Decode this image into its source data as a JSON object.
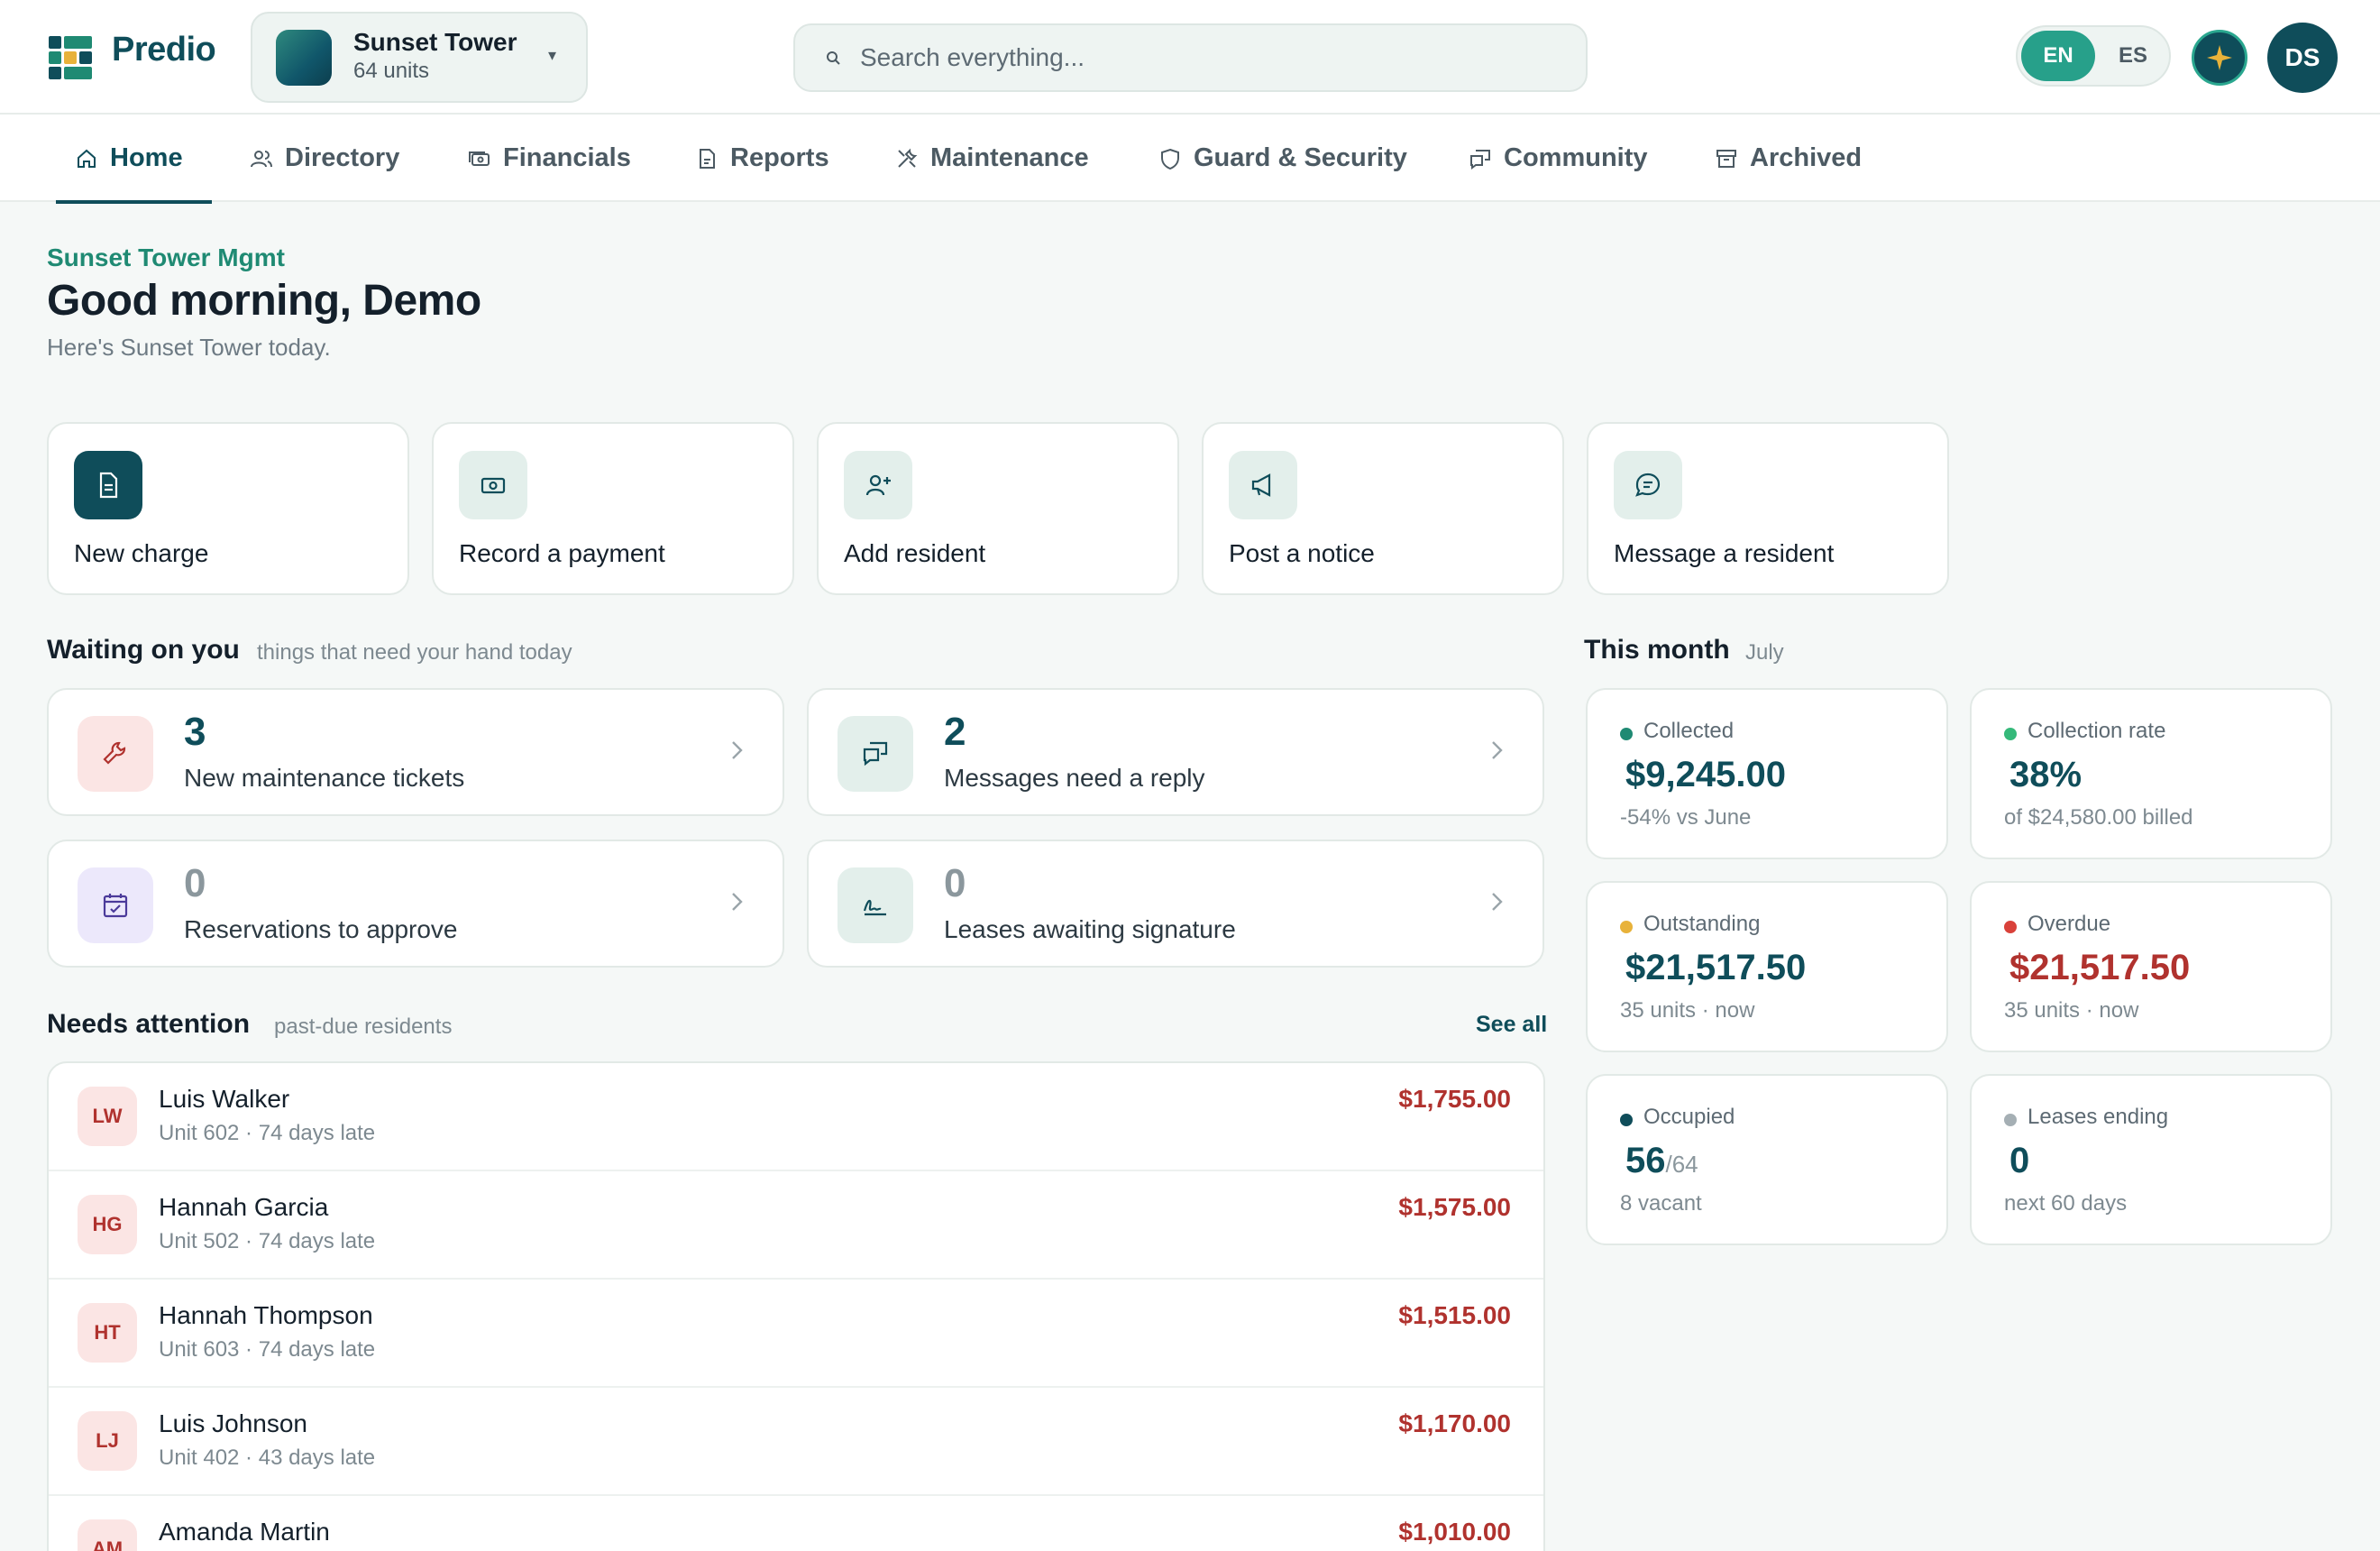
{
  "app": {
    "brand": "Predio",
    "building": {
      "name": "Sunset Tower",
      "units": "64 units"
    },
    "search_placeholder": "Search everything...",
    "lang": {
      "en": "EN",
      "es": "ES"
    },
    "avatar_initials": "DS",
    "accent_color": "#0f4d5a",
    "positive_color": "#27a08a",
    "danger_color": "#b0322e"
  },
  "nav": {
    "tabs": [
      {
        "label": "Home",
        "icon": "home-icon",
        "active": true
      },
      {
        "label": "Directory",
        "icon": "users-icon"
      },
      {
        "label": "Financials",
        "icon": "money-icon"
      },
      {
        "label": "Reports",
        "icon": "report-icon"
      },
      {
        "label": "Maintenance",
        "icon": "tools-icon"
      },
      {
        "label": "Guard & Security",
        "icon": "shield-icon"
      },
      {
        "label": "Community",
        "icon": "chat-icon"
      },
      {
        "label": "Archived",
        "icon": "archive-icon"
      }
    ]
  },
  "header": {
    "org": "Sunset Tower Mgmt",
    "greeting": "Good morning, Demo",
    "subtitle": "Here's Sunset Tower today."
  },
  "quick_actions": [
    {
      "label": "New charge",
      "icon": "document-icon"
    },
    {
      "label": "Record a payment",
      "icon": "cash-icon"
    },
    {
      "label": "Add resident",
      "icon": "user-plus-icon"
    },
    {
      "label": "Post a notice",
      "icon": "megaphone-icon"
    },
    {
      "label": "Message a resident",
      "icon": "message-icon"
    }
  ],
  "waiting": {
    "title": "Waiting on you",
    "subtitle": "things that need your hand today",
    "cards": [
      {
        "count": "3",
        "label": "New maintenance tickets",
        "icon": "wrench-icon"
      },
      {
        "count": "2",
        "label": "Messages need a reply",
        "icon": "messages-icon"
      },
      {
        "count": "0",
        "label": "Reservations to approve",
        "icon": "calendar-check-icon"
      },
      {
        "count": "0",
        "label": "Leases awaiting signature",
        "icon": "signature-icon"
      }
    ]
  },
  "attention": {
    "title": "Needs attention",
    "subtitle": "past-due residents",
    "see_all": "See all",
    "rows": [
      {
        "initials": "LW",
        "name": "Luis Walker",
        "detail": "Unit 602 · 74 days late",
        "amount": "$1,755.00"
      },
      {
        "initials": "HG",
        "name": "Hannah Garcia",
        "detail": "Unit 502 · 74 days late",
        "amount": "$1,575.00"
      },
      {
        "initials": "HT",
        "name": "Hannah Thompson",
        "detail": "Unit 603 · 74 days late",
        "amount": "$1,515.00"
      },
      {
        "initials": "LJ",
        "name": "Luis Johnson",
        "detail": "Unit 402 · 43 days late",
        "amount": "$1,170.00"
      },
      {
        "initials": "AM",
        "name": "Amanda Martin",
        "detail": "",
        "amount": "$1,010.00"
      }
    ]
  },
  "month": {
    "title": "This month",
    "subtitle": "July",
    "stats": [
      {
        "label": "Collected",
        "value": "$9,245.00",
        "note": "-54% vs June",
        "dot": "#1f8a73"
      },
      {
        "label": "Collection rate",
        "value": "38%",
        "note": "of $24,580.00 billed",
        "dot": "#35b97a"
      },
      {
        "label": "Outstanding",
        "value": "$21,517.50",
        "note": "35 units · now",
        "dot": "#e8b23a"
      },
      {
        "label": "Overdue",
        "value": "$21,517.50",
        "note": "35 units · now",
        "dot": "#d9413a"
      },
      {
        "label": "Occupied",
        "value": "56",
        "value_suffix": "/64",
        "note": "8 vacant",
        "dot": "#0f4d5a"
      },
      {
        "label": "Leases ending",
        "value": "0",
        "note": "next 60 days",
        "dot": "#a5afb4"
      }
    ]
  }
}
